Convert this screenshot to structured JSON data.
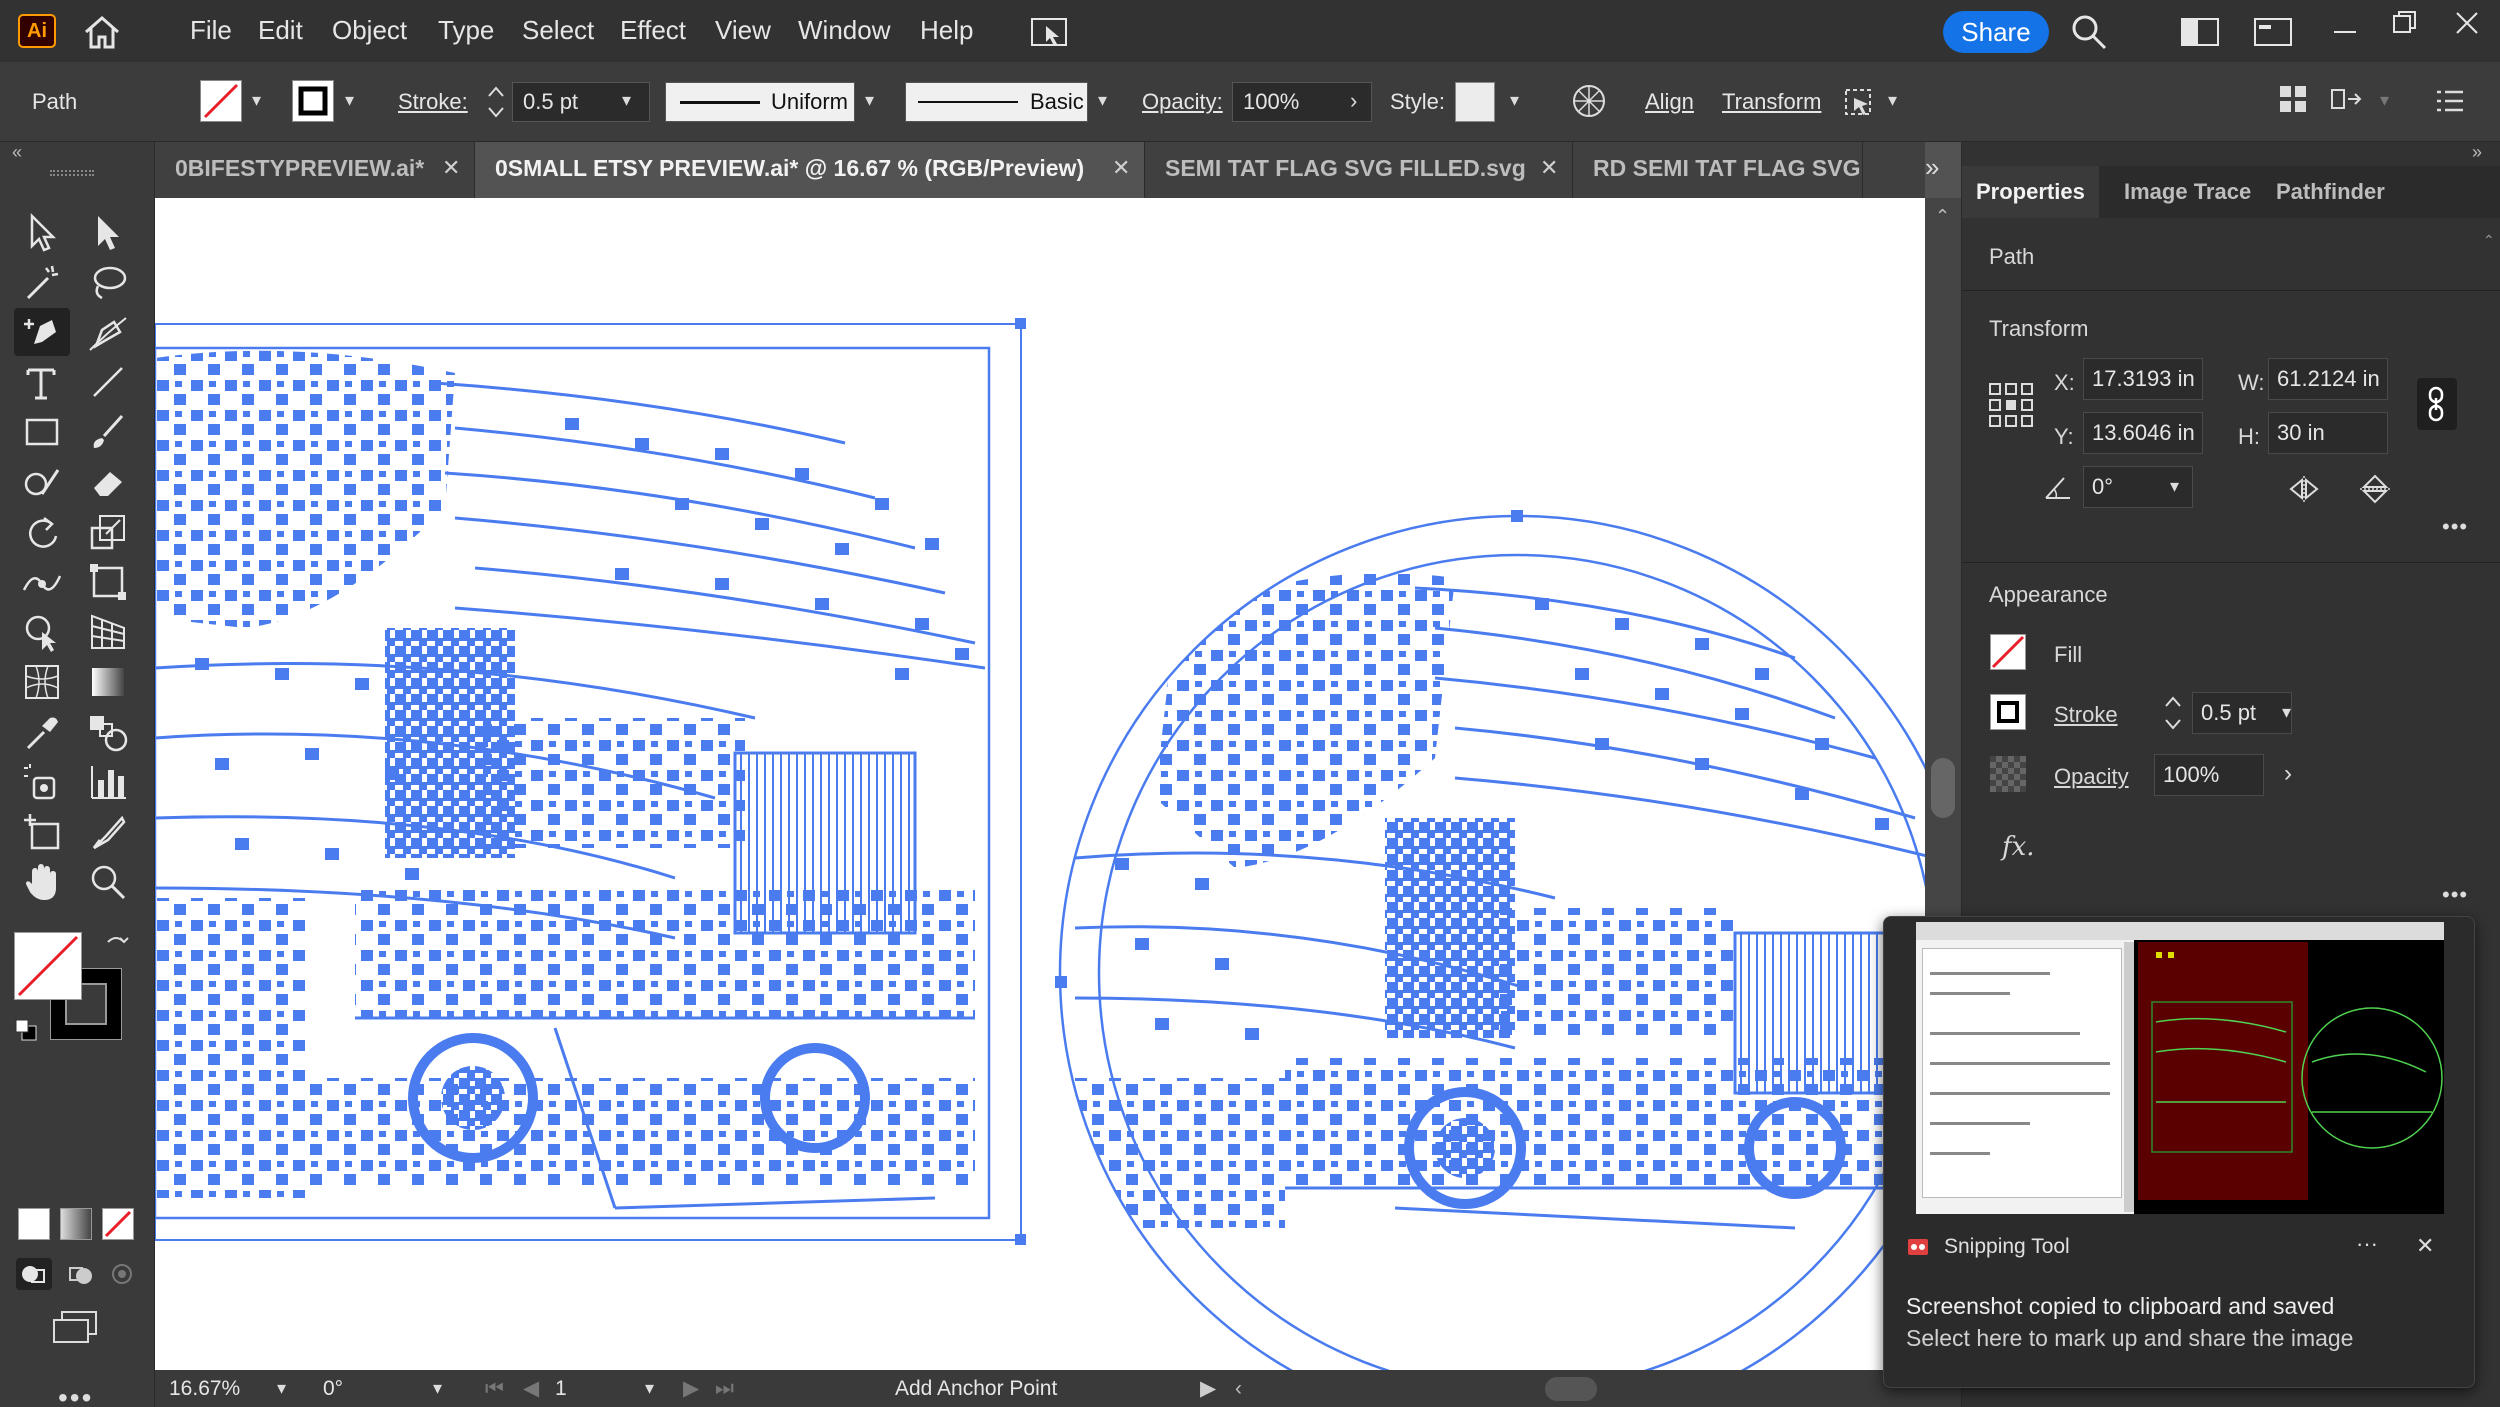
{
  "app": {
    "logo": "Ai"
  },
  "menu": [
    "File",
    "Edit",
    "Object",
    "Type",
    "Select",
    "Effect",
    "View",
    "Window",
    "Help"
  ],
  "share_label": "Share",
  "control": {
    "selection_type": "Path",
    "stroke_label": "Stroke:",
    "stroke_value": "0.5 pt",
    "profile_label": "Uniform",
    "brush_label": "Basic",
    "opacity_label": "Opacity:",
    "opacity_value": "100%",
    "style_label": "Style:",
    "align_label": "Align",
    "transform_label": "Transform"
  },
  "tabs": [
    {
      "label": "0BIFESTYPREVIEW.ai*"
    },
    {
      "label": "0SMALL ETSY PREVIEW.ai* @ 16.67 % (RGB/Preview)"
    },
    {
      "label": "SEMI TAT FLAG SVG FILLED.svg"
    },
    {
      "label": "RD SEMI TAT FLAG SVG FI"
    }
  ],
  "panel": {
    "tabs": [
      "Properties",
      "Image Trace",
      "Pathfinder"
    ],
    "object_type": "Path",
    "transform": {
      "title": "Transform",
      "x_label": "X:",
      "x_value": "17.3193 in",
      "y_label": "Y:",
      "y_value": "13.6046 in",
      "w_label": "W:",
      "w_value": "61.2124 in",
      "h_label": "H:",
      "h_value": "30 in",
      "angle_value": "0°"
    },
    "appearance": {
      "title": "Appearance",
      "fill_label": "Fill",
      "stroke_label": "Stroke",
      "stroke_value": "0.5 pt",
      "opacity_label": "Opacity",
      "opacity_value": "100%",
      "fx_label": "fx."
    }
  },
  "status": {
    "zoom": "16.67%",
    "rotation": "0°",
    "artboard_number": "1",
    "tool_hint": "Add Anchor Point"
  },
  "notification": {
    "app_name": "Snipping Tool",
    "more": "···",
    "close": "✕",
    "message_line1": "Screenshot copied to clipboard and saved",
    "message_line2": "Select here to mark up and share the image"
  },
  "colors": {
    "selection": "#4a7cf0",
    "accent": "#1473e6",
    "app_orange": "#ff9a00"
  }
}
